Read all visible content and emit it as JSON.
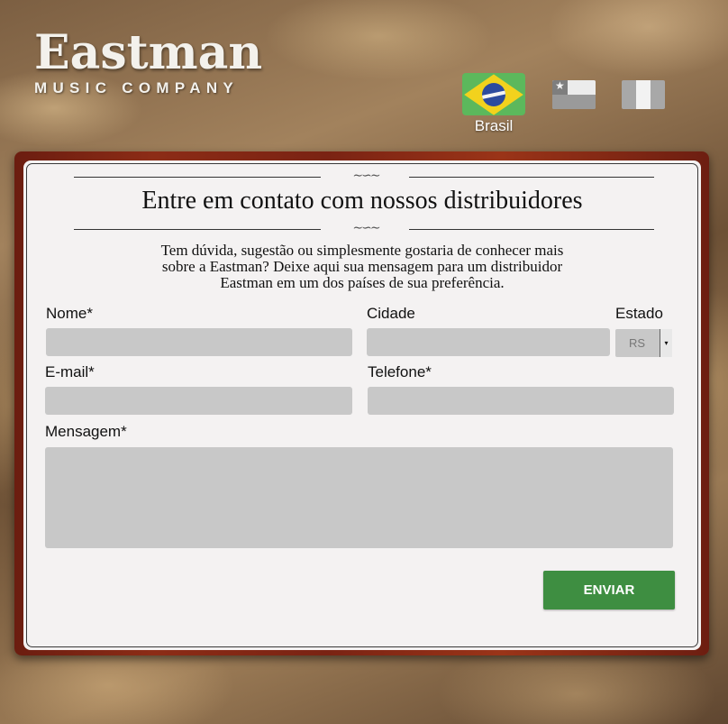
{
  "logo": {
    "main": "Eastman",
    "sub": "MUSIC COMPANY"
  },
  "countries": [
    {
      "label": "Brasil",
      "flag": "brazil-flag",
      "selected": true
    },
    {
      "label": "",
      "flag": "chile-flag",
      "selected": false
    },
    {
      "label": "",
      "flag": "uruguay-flag",
      "selected": false
    }
  ],
  "contact": {
    "title": "Entre em contato com nossos distribuidores",
    "intro": [
      "Tem dúvida, sugestão ou simplesmente gostaria de conhecer mais",
      "sobre a Eastman? Deixe aqui sua mensagem para um distribuidor",
      "Eastman em um dos países de sua preferência."
    ],
    "fields": {
      "nome": {
        "label": "Nome*",
        "value": ""
      },
      "cidade": {
        "label": "Cidade",
        "value": ""
      },
      "estado": {
        "label": "Estado",
        "value": "RS"
      },
      "email": {
        "label": "E-mail*",
        "value": ""
      },
      "telefone": {
        "label": "Telefone*",
        "value": ""
      },
      "mensagem": {
        "label": "Mensagem*",
        "value": ""
      }
    },
    "submit_label": "ENVIAR"
  },
  "colors": {
    "submit_bg": "#3e8e41",
    "frame": "#8c2c16",
    "card_bg": "#f4f2f2",
    "field_bg": "#c8c8c8"
  }
}
